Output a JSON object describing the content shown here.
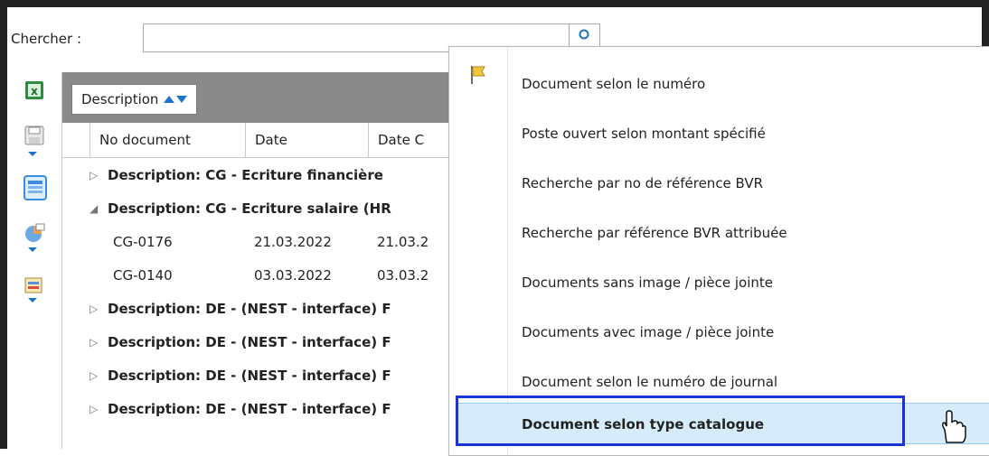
{
  "search": {
    "label": "Chercher :",
    "value": "",
    "placeholder": ""
  },
  "toolbar": {
    "icons": [
      "excel-icon",
      "save-icon",
      "list-view-icon",
      "chart-icon",
      "layout-icon"
    ]
  },
  "grid": {
    "group_by": "Description",
    "columns": [
      "No document",
      "Date",
      "Date C"
    ],
    "rows": [
      {
        "type": "group",
        "expander": "▷",
        "text": "Description: CG - Ecriture financière"
      },
      {
        "type": "group",
        "expander": "◢",
        "text": "Description: CG - Ecriture salaire (HR"
      },
      {
        "type": "data",
        "no": "CG-0176",
        "date": "21.03.2022",
        "date2": "21.03.2"
      },
      {
        "type": "data",
        "no": "CG-0140",
        "date": "03.03.2022",
        "date2": "03.03.2"
      },
      {
        "type": "group",
        "expander": "▷",
        "text": "Description: DE - (NEST - interface) F"
      },
      {
        "type": "group",
        "expander": "▷",
        "text": "Description: DE - (NEST - interface) F"
      },
      {
        "type": "group",
        "expander": "▷",
        "text": "Description: DE - (NEST - interface) F"
      },
      {
        "type": "group",
        "expander": "▷",
        "text": "Description: DE - (NEST - interface) F"
      }
    ]
  },
  "menu": {
    "items": [
      "Document selon le numéro",
      "Poste ouvert selon montant spécifié",
      "Recherche par no de référence BVR",
      "Recherche par référence BVR attribuée",
      "Documents sans image / pièce jointe",
      "Documents avec image / pièce jointe",
      "Document selon le numéro de journal",
      "Document selon type catalogue"
    ],
    "selected_index": 7
  },
  "colors": {
    "accent": "#1e73c9",
    "group_panel": "#8a8a8a",
    "highlight_border": "#1a33d6",
    "hover_bg": "#d6ecfb"
  }
}
